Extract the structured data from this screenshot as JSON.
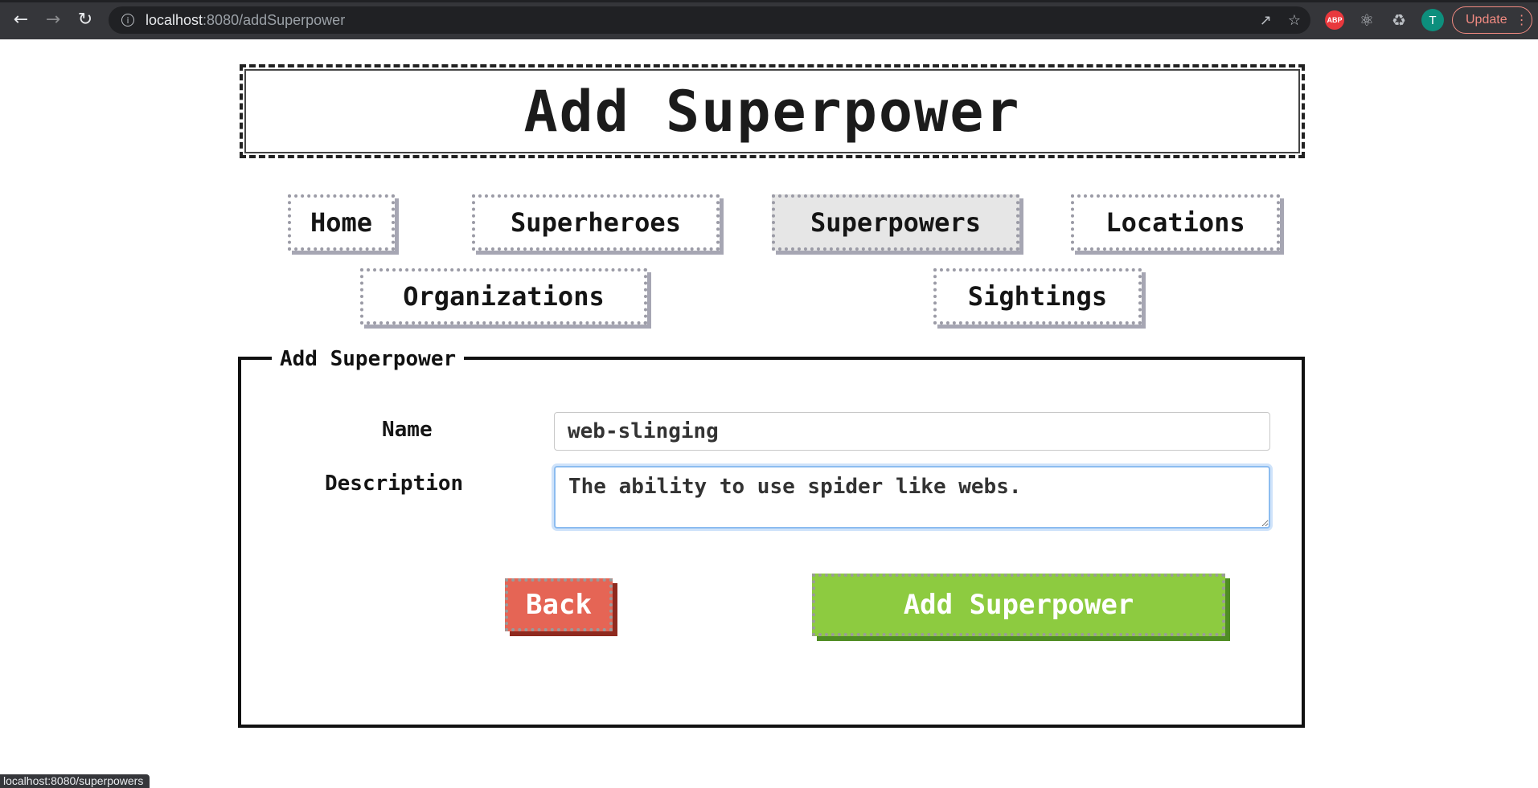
{
  "browser": {
    "url_host": "localhost",
    "url_rest": ":8080/addSuperpower",
    "update_label": "Update",
    "profile_initial": "T",
    "extension_abp": "ABP",
    "icons": [
      "back-arrow-icon",
      "forward-arrow-icon",
      "reload-icon",
      "info-icon",
      "share-icon",
      "star-icon",
      "react-devtools-icon",
      "puzzle-icon",
      "more-icon"
    ]
  },
  "header": {
    "title": "Add Superpower"
  },
  "nav": {
    "home": "Home",
    "superheroes": "Superheroes",
    "superpowers": "Superpowers",
    "locations": "Locations",
    "organizations": "Organizations",
    "sightings": "Sightings",
    "active": "Superpowers"
  },
  "form": {
    "legend": "Add Superpower",
    "name_label": "Name",
    "name_value": "web-slinging",
    "description_label": "Description",
    "description_value": "The ability to use spider like webs.",
    "back_label": "Back",
    "submit_label": "Add Superpower"
  },
  "status_bar": {
    "text": "localhost:8080/superpowers"
  },
  "colors": {
    "back_button": "#e56555",
    "submit_button": "#8dcb40",
    "focus_ring": "#8cbcf0"
  }
}
